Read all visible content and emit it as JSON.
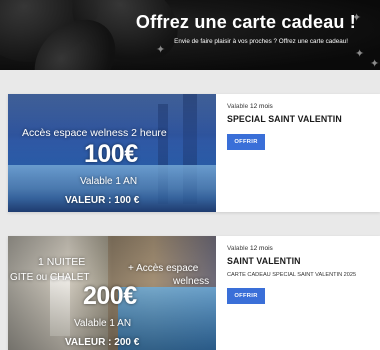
{
  "banner": {
    "title": "Offrez une carte cadeau !",
    "subtitle": "Envie de faire plaisir à vos proches ? Offrez une carte cadeau!"
  },
  "cards": [
    {
      "image_text": {
        "line1": "Accès espace welness 2 heure",
        "price": "100€",
        "validity": "Valable 1 AN",
        "value": "VALEUR : 100 €"
      },
      "validity_prefix": "Valable",
      "validity_value": "12 mois",
      "name": "SPECIAL SAINT VALENTIN",
      "description": "",
      "button_label": "OFFRIR"
    },
    {
      "image_text": {
        "line1": "1 NUITEE",
        "line2": "GITE ou CHALET",
        "line3": "+ Accès espace",
        "line4": "welness",
        "price": "200€",
        "validity": "Valable 1 AN",
        "value": "VALEUR : 200 €"
      },
      "validity_prefix": "Valable",
      "validity_value": "12 mois",
      "name": "SAINT VALENTIN",
      "description": "CARTE CADEAU SPECIAL SAINT VALENTIN 2025",
      "button_label": "OFFRIR"
    }
  ],
  "colors": {
    "button": "#3a6fd8",
    "banner_bg": "#0c0c0c"
  }
}
